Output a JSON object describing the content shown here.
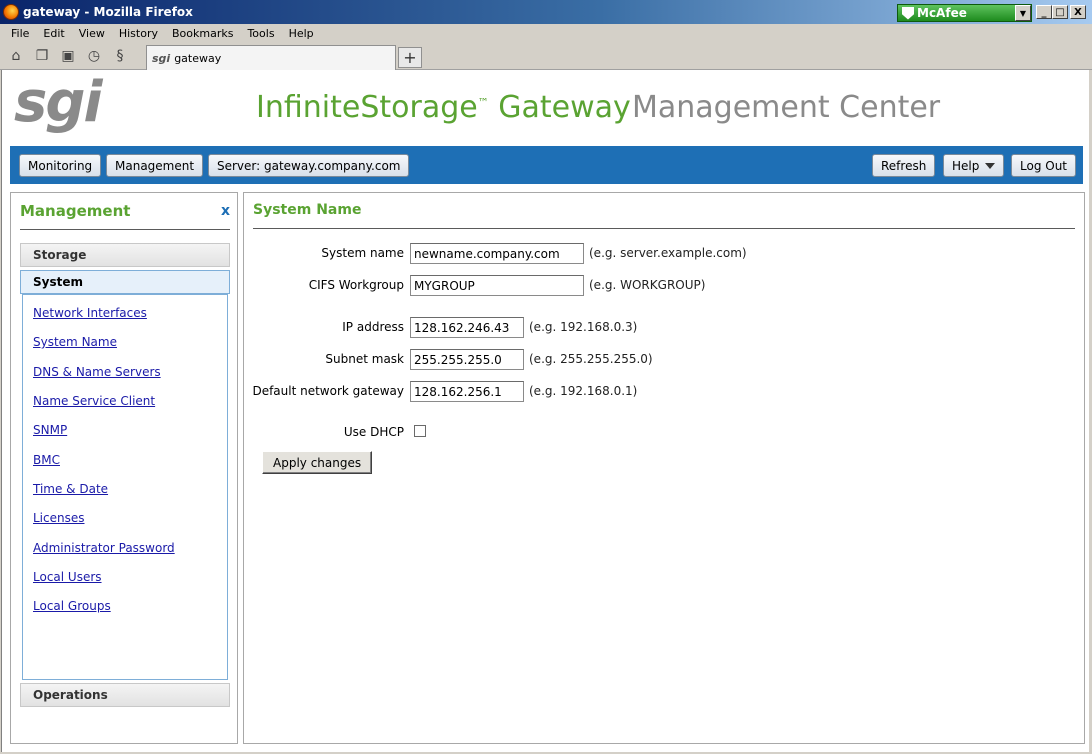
{
  "window": {
    "title": "gateway - Mozilla Firefox",
    "addon": "McAfee",
    "min_glyph": "_",
    "max_glyph": "□",
    "close_glyph": "X"
  },
  "menu": [
    "File",
    "Edit",
    "View",
    "History",
    "Bookmarks",
    "Tools",
    "Help"
  ],
  "tab": {
    "favicon": "sgi",
    "label": "gateway",
    "newtab_glyph": "+"
  },
  "header": {
    "logo": "sgi",
    "brand": "InfiniteStorage",
    "brand_tm": "™",
    "brand_suffix": " Gateway",
    "subtitle": "Management Center"
  },
  "navbar": {
    "monitoring": "Monitoring",
    "management": "Management",
    "server": "Server: gateway.company.com",
    "refresh": "Refresh",
    "help": "Help",
    "logout": "Log Out"
  },
  "sidebar": {
    "title": "Management",
    "close": "x",
    "sections": {
      "storage": "Storage",
      "system": "System",
      "operations": "Operations"
    },
    "links": [
      "Network Interfaces",
      "System Name",
      "DNS & Name Servers",
      "Name Service Client",
      "SNMP",
      "BMC",
      "Time & Date",
      "Licenses",
      "Administrator Password",
      "Local Users",
      "Local Groups"
    ]
  },
  "main": {
    "title": "System Name",
    "fields": {
      "system_name": {
        "label": "System name",
        "value": "newname.company.com",
        "hint": "(e.g. server.example.com)"
      },
      "workgroup": {
        "label": "CIFS Workgroup",
        "value": "MYGROUP",
        "hint": "(e.g. WORKGROUP)"
      },
      "ip": {
        "label": "IP address",
        "value": "128.162.246.43",
        "hint": "(e.g. 192.168.0.3)"
      },
      "subnet": {
        "label": "Subnet mask",
        "value": "255.255.255.0",
        "hint": "(e.g. 255.255.255.0)"
      },
      "gateway": {
        "label": "Default network gateway",
        "value": "128.162.256.1",
        "hint": "(e.g. 192.168.0.1)"
      },
      "dhcp": {
        "label": "Use DHCP"
      }
    },
    "apply": "Apply changes"
  }
}
